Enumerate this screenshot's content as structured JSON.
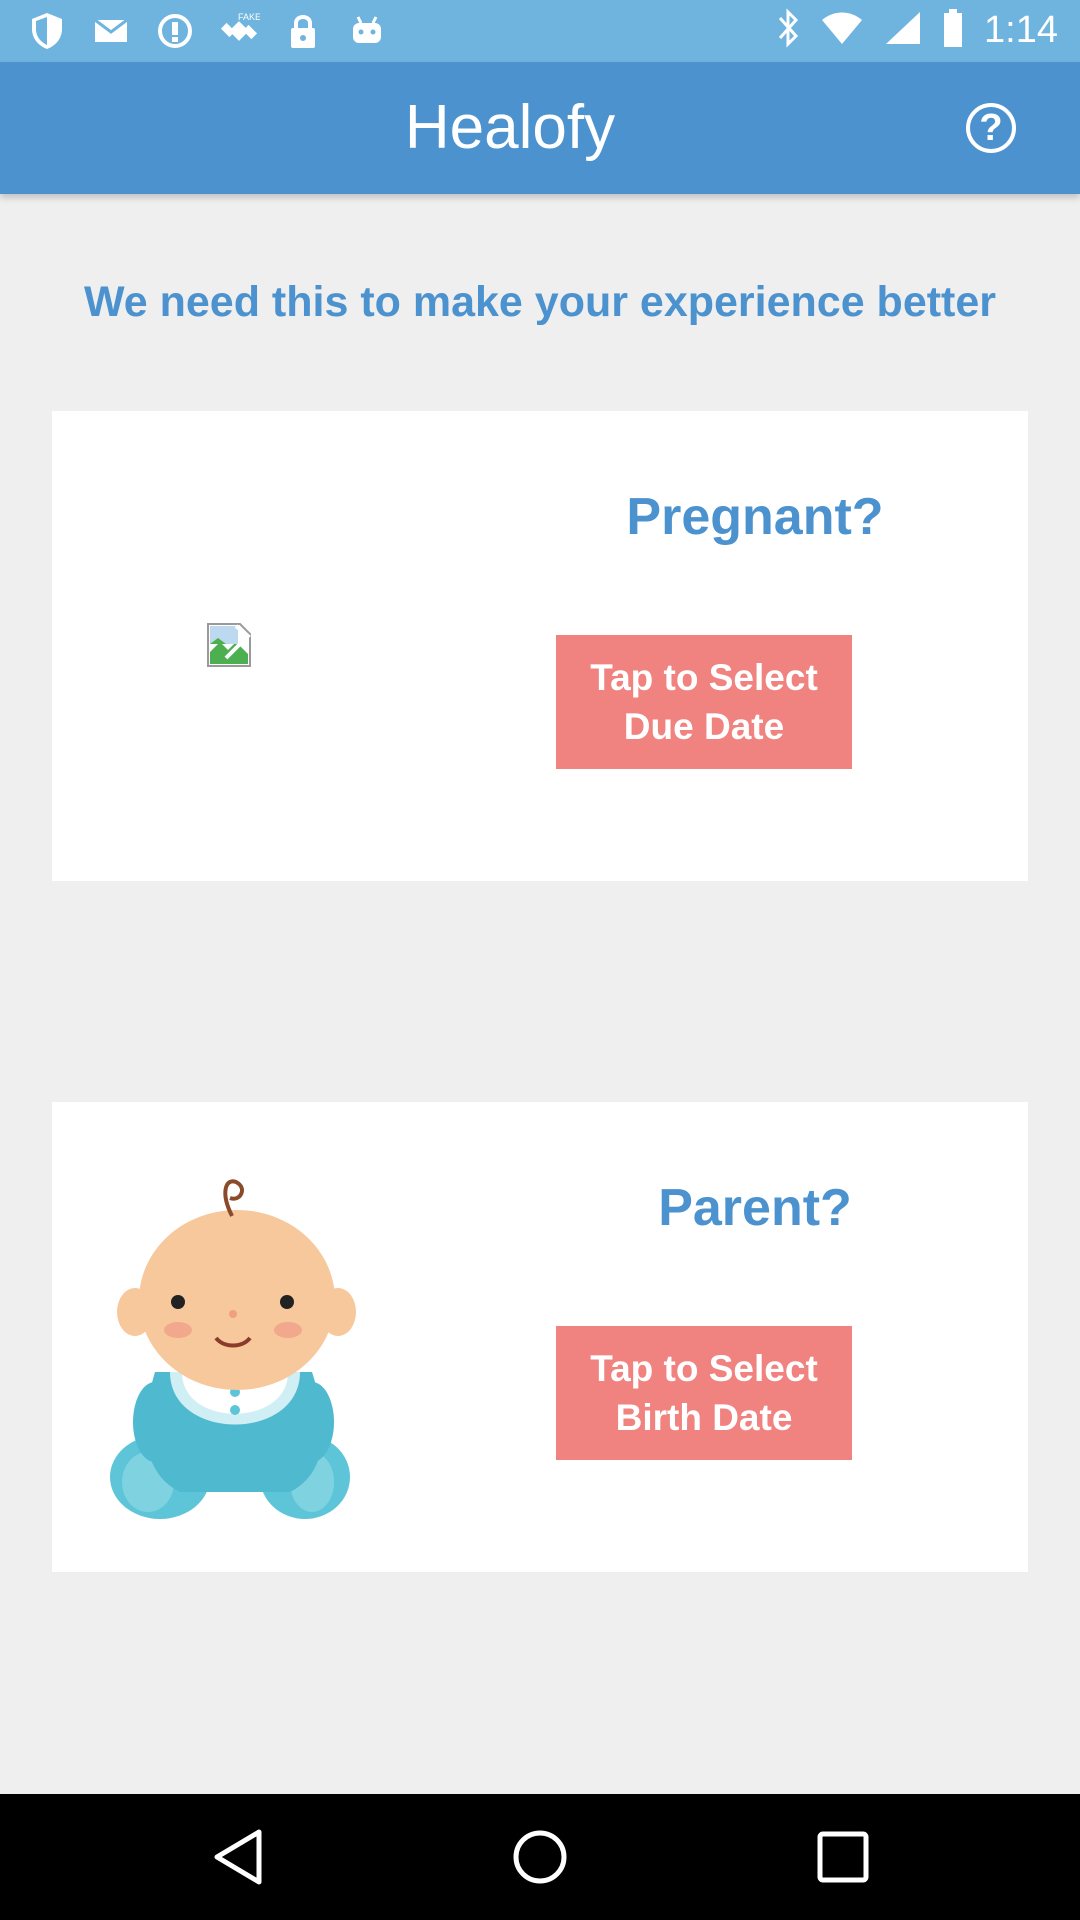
{
  "status_bar": {
    "icons_left": [
      "shield-icon",
      "mail-icon",
      "info-circle-icon",
      "fake-gps-icon",
      "lock-icon",
      "android-icon"
    ],
    "icons_right": [
      "bluetooth-icon",
      "wifi-icon",
      "signal-icon",
      "battery-icon"
    ],
    "time": "1:14"
  },
  "app_bar": {
    "title": "Healofy",
    "help_icon": "?"
  },
  "headline": "We need this to make your experience better",
  "pregnant_card": {
    "question": "Pregnant?",
    "button_label": "Tap to Select Due Date"
  },
  "parent_card": {
    "question": "Parent?",
    "button_label": "Tap to Select Birth Date"
  },
  "nav_bar": {
    "icons": [
      "back-icon",
      "home-icon",
      "recents-icon"
    ]
  },
  "colors": {
    "status_bar": "#6fb3df",
    "app_bar": "#4b92cf",
    "accent_text": "#4b92cf",
    "button": "#f0837f",
    "background": "#efefef"
  }
}
